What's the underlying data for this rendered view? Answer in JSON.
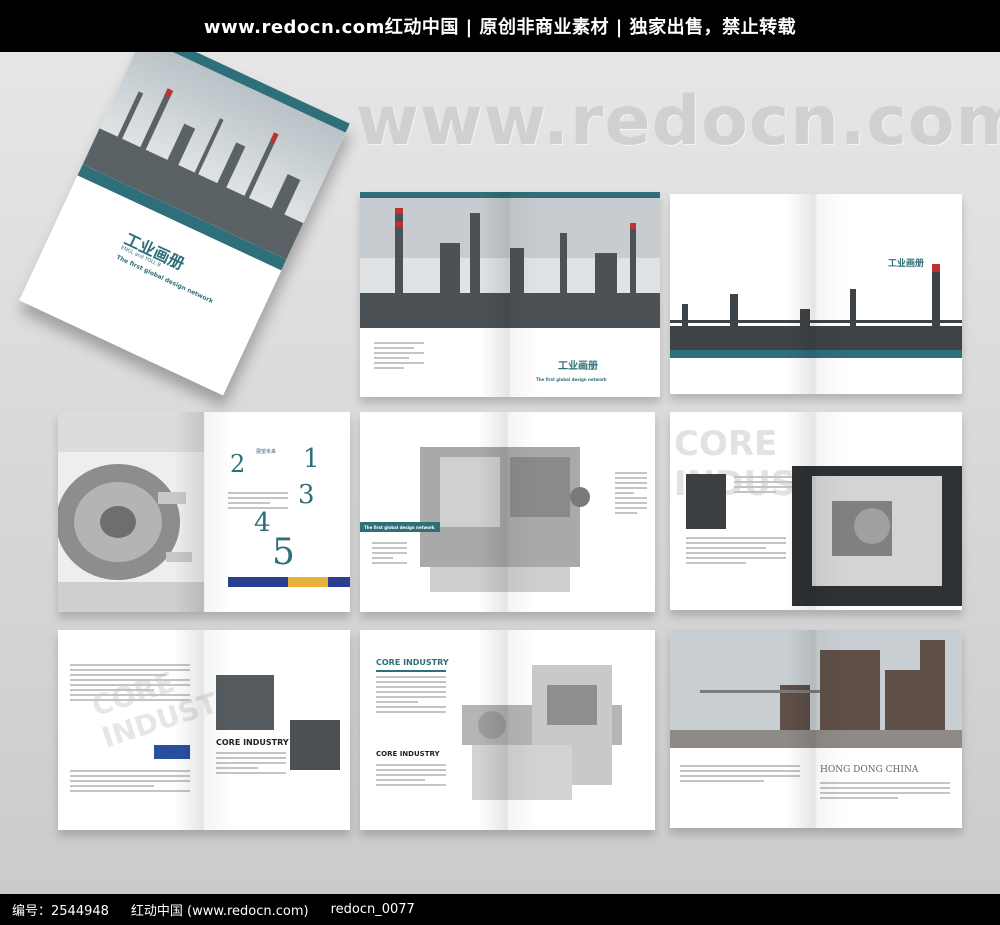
{
  "header": {
    "banner": "www.redocn.com红动中国 | 原创非商业素材 | 独家出售，禁止转载"
  },
  "watermark": "www.redocn.com",
  "cover": {
    "title_cn": "工业画册",
    "subtitle": "ENGL and YOLL B",
    "tagline": "The first global design network"
  },
  "spread1": {
    "title_cn": "工业画册",
    "tagline": "The first global design network"
  },
  "spread2": {
    "title_cn": "工业画册"
  },
  "spread3": {
    "title_cn": "展望未来",
    "numbers": [
      "2",
      "1",
      "3",
      "4",
      "5"
    ]
  },
  "spread4": {
    "tagline": "The first global design network"
  },
  "spread5": {
    "heading": "CORE INDUSTRY"
  },
  "spread6": {
    "big_heading": "CORE INDUSTRY",
    "heading": "CORE INDUSTRY"
  },
  "spread7": {
    "heading": "CORE INDUSTRY",
    "heading2": "CORE INDUSTRY"
  },
  "spread8": {
    "heading": "HONG DONG CHINA"
  },
  "footer": {
    "id": "编号：2544948",
    "site": "红动中国 (www.redocn.com)",
    "user": "redocn_0077"
  },
  "colors": {
    "accent": "#2f6f7a",
    "navy": "#2a3f8f",
    "gold": "#e8b23a"
  }
}
